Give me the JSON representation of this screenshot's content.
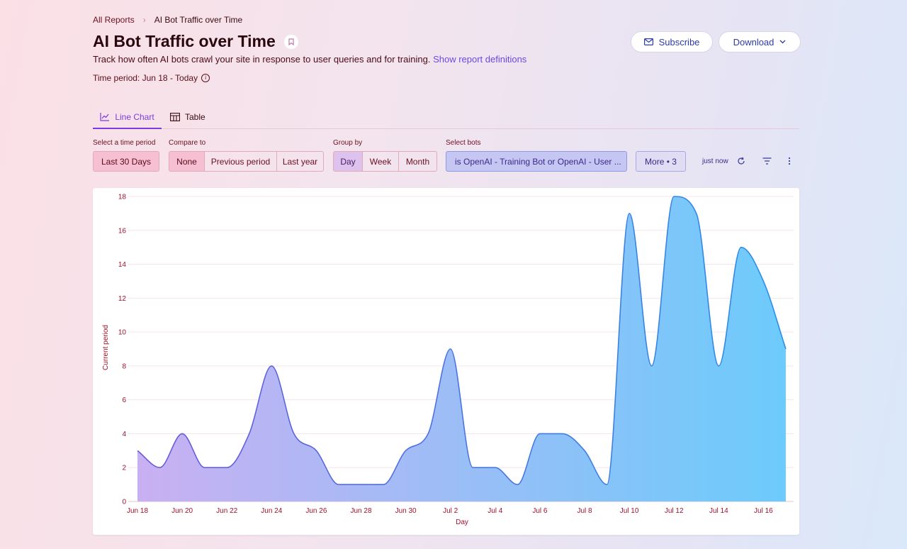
{
  "breadcrumb": {
    "parent": "All Reports",
    "separator": "›",
    "current": "AI Bot Traffic over Time"
  },
  "page": {
    "title": "AI Bot Traffic over Time",
    "subtitle": "Track how often AI bots crawl your site in response to user queries and for training.",
    "definitions_link": "Show report definitions",
    "time_period": "Time period: Jun 18 - Today"
  },
  "header_buttons": {
    "subscribe": "Subscribe",
    "download": "Download"
  },
  "tabs": [
    {
      "label": "Line Chart",
      "active": true
    },
    {
      "label": "Table",
      "active": false
    }
  ],
  "filters": {
    "time_period": {
      "label": "Select a time period",
      "value": "Last 30 Days"
    },
    "compare_to": {
      "label": "Compare to",
      "options": [
        "None",
        "Previous period",
        "Last year"
      ],
      "selected": "None"
    },
    "group_by": {
      "label": "Group by",
      "options": [
        "Day",
        "Week",
        "Month"
      ],
      "selected": "Day"
    },
    "bots": {
      "label": "Select bots",
      "value": "is OpenAI - Training Bot or OpenAI - User ..."
    },
    "more": "More • 3",
    "updated": "just now"
  },
  "colors": {
    "accent": "#7a3ce0",
    "line": "#3d7be0",
    "fill_start": "#c9b0f2",
    "fill_end": "#6ccbfb",
    "axis_text": "#a0102a"
  },
  "chart_data": {
    "type": "area",
    "xlabel": "Day",
    "ylabel": "Current period",
    "ylim": [
      0,
      18
    ],
    "y_ticks": [
      0,
      2,
      4,
      6,
      8,
      10,
      12,
      14,
      16,
      18
    ],
    "x": [
      "Jun 18",
      "Jun 19",
      "Jun 20",
      "Jun 21",
      "Jun 22",
      "Jun 23",
      "Jun 24",
      "Jun 25",
      "Jun 26",
      "Jun 27",
      "Jun 28",
      "Jun 29",
      "Jun 30",
      "Jul 1",
      "Jul 2",
      "Jul 3",
      "Jul 4",
      "Jul 5",
      "Jul 6",
      "Jul 7",
      "Jul 8",
      "Jul 9",
      "Jul 10",
      "Jul 11",
      "Jul 12",
      "Jul 13",
      "Jul 14",
      "Jul 15",
      "Jul 16",
      "Jul 17"
    ],
    "x_tick_labels": [
      "Jun 18",
      "Jun 20",
      "Jun 22",
      "Jun 24",
      "Jun 26",
      "Jun 28",
      "Jun 30",
      "Jul 2",
      "Jul 4",
      "Jul 6",
      "Jul 8",
      "Jul 10",
      "Jul 12",
      "Jul 14",
      "Jul 16"
    ],
    "series": [
      {
        "values": [
          3,
          2,
          4,
          2,
          2,
          4,
          8,
          4,
          3,
          1,
          1,
          1,
          3,
          4,
          9,
          2,
          2,
          1,
          4,
          4,
          3,
          1,
          17,
          8,
          18,
          17,
          8,
          15,
          13,
          9
        ]
      }
    ],
    "grid": true,
    "legend": "none"
  }
}
